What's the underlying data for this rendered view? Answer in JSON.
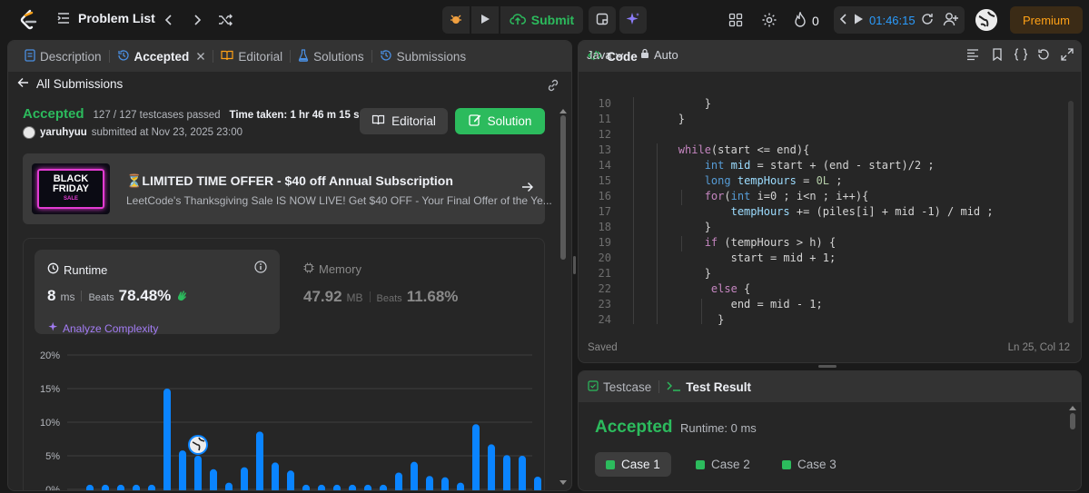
{
  "topbar": {
    "problem_list": "Problem List",
    "submit": "Submit",
    "streak": "0",
    "timer": "01:46:15",
    "premium": "Premium"
  },
  "left_tabs": [
    {
      "label": "Description",
      "icon": "description-icon"
    },
    {
      "label": "Accepted",
      "icon": "history-icon"
    },
    {
      "label": "Editorial",
      "icon": "book-icon"
    },
    {
      "label": "Solutions",
      "icon": "flask-icon"
    },
    {
      "label": "Submissions",
      "icon": "history-icon"
    }
  ],
  "submission": {
    "all_submissions": "All Submissions",
    "status": "Accepted",
    "testcases": "127 / 127 testcases passed",
    "time_taken": "Time taken: 1 hr 46 m 15 s",
    "user": "yaruhyuu",
    "submitted_at": "submitted at Nov 23, 2025 23:00",
    "editorial_btn": "Editorial",
    "solution_btn": "Solution"
  },
  "promo": {
    "title": "⏳LIMITED TIME OFFER - $40 off Annual Subscription",
    "subtitle": "LeetCode's Thanksgiving Sale IS NOW LIVE! Get $40 OFF - Your Final Offer of the Ye...",
    "image_text_1": "BLACK",
    "image_text_2": "FRIDAY",
    "image_text_3": "SALE"
  },
  "runtime": {
    "label": "Runtime",
    "value": "8",
    "unit": "ms",
    "beats_label": "Beats",
    "beats": "78.48%",
    "analyze": "Analyze Complexity"
  },
  "memory": {
    "label": "Memory",
    "value": "47.92",
    "unit": "MB",
    "beats_label": "Beats",
    "beats": "11.68%"
  },
  "chart_data": {
    "type": "bar",
    "yticks": [
      "20%",
      "15%",
      "10%",
      "5%",
      "0%"
    ],
    "ylim": [
      0,
      20
    ],
    "values": [
      0.7,
      0.7,
      0.7,
      0.7,
      0.7,
      15.0,
      5.8,
      5.0,
      3.0,
      1.0,
      3.3,
      8.6,
      4.0,
      2.8,
      0.7,
      0.7,
      0.7,
      0.7,
      0.7,
      0.7,
      2.5,
      4.1,
      2.0,
      1.8,
      1.0,
      9.7,
      6.7,
      5.1,
      5.0,
      1.9
    ],
    "marker_index": 7,
    "bar_color": "#0a84ff"
  },
  "code": {
    "title": "Code",
    "language": "Java",
    "mode": "Auto",
    "status": "Saved",
    "cursor": "Ln 25, Col 12",
    "lines": [
      {
        "n": "10",
        "text": "            }"
      },
      {
        "n": "11",
        "text": "        }"
      },
      {
        "n": "12",
        "text": ""
      },
      {
        "n": "13",
        "text": "        while(start <= end){"
      },
      {
        "n": "14",
        "text": "            int mid = start + (end - start)/2 ;"
      },
      {
        "n": "15",
        "text": "            long tempHours = 0L ;"
      },
      {
        "n": "16",
        "text": "            for(int i=0 ; i<n ; i++){"
      },
      {
        "n": "17",
        "text": "                tempHours += (piles[i] + mid -1) / mid ;"
      },
      {
        "n": "18",
        "text": "            }"
      },
      {
        "n": "19",
        "text": "            if (tempHours > h) {"
      },
      {
        "n": "20",
        "text": "                start = mid + 1;"
      },
      {
        "n": "21",
        "text": "            }"
      },
      {
        "n": "22",
        "text": "             else {"
      },
      {
        "n": "23",
        "text": "                end = mid - 1;"
      },
      {
        "n": "24",
        "text": "              }"
      }
    ]
  },
  "test": {
    "tab_testcase": "Testcase",
    "tab_result": "Test Result",
    "status": "Accepted",
    "runtime": "Runtime: 0 ms",
    "cases": [
      "Case 1",
      "Case 2",
      "Case 3"
    ]
  }
}
